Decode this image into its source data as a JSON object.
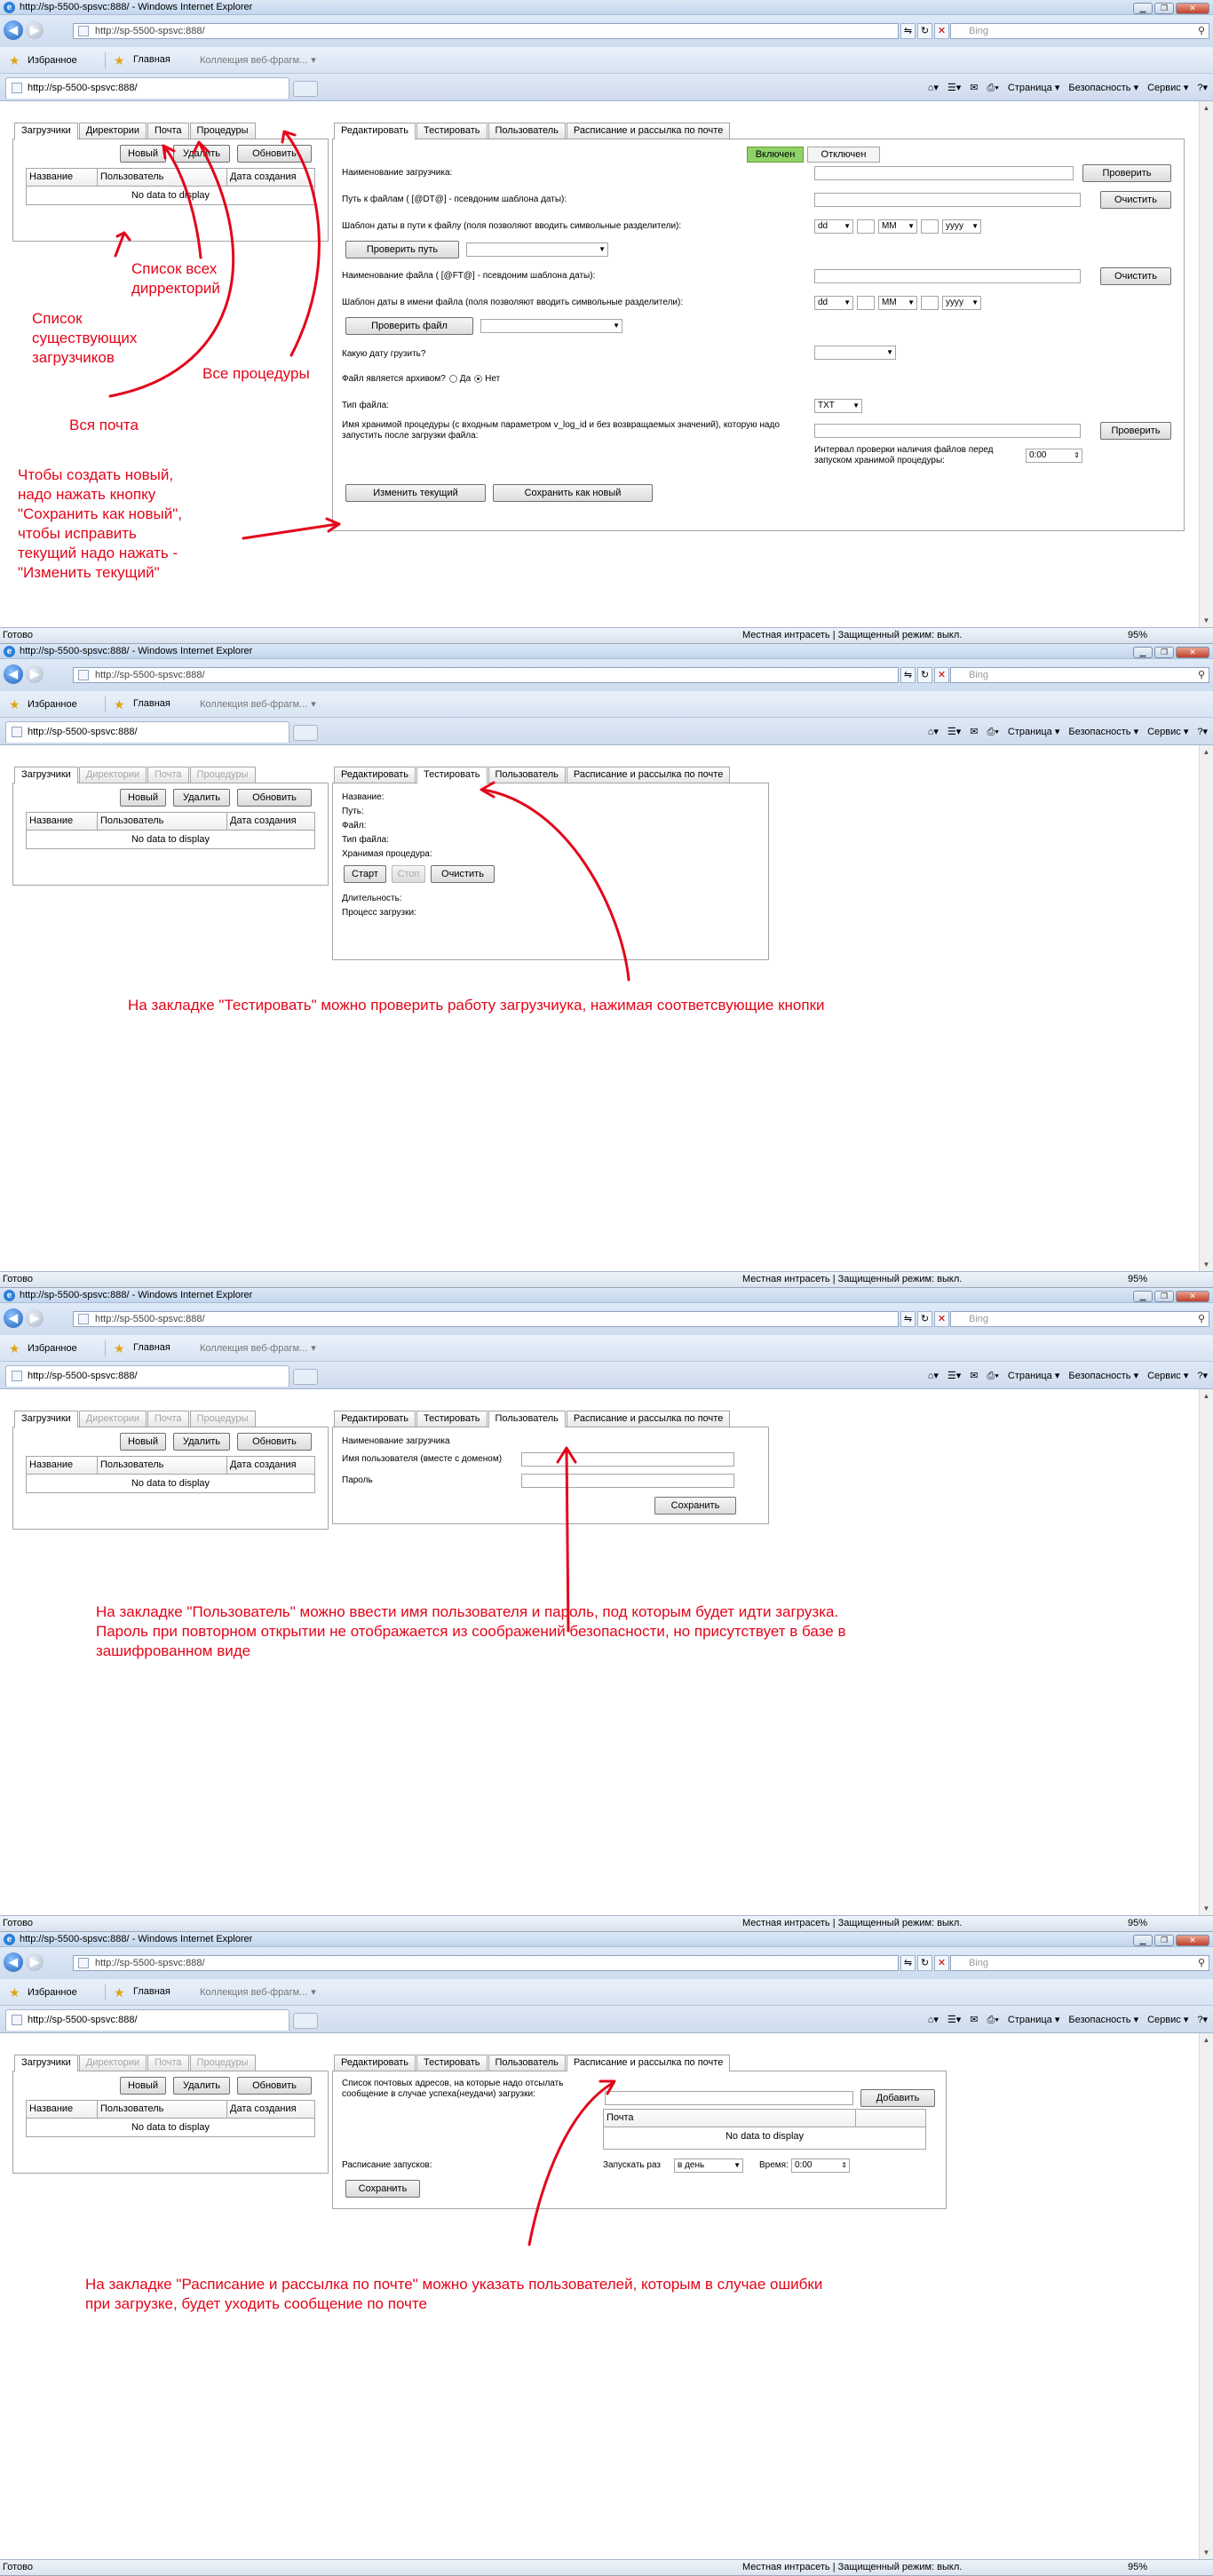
{
  "ie": {
    "title": "http://sp-5500-spsvc:888/ - Windows Internet Explorer",
    "address": "http://sp-5500-spsvc:888/",
    "search_placeholder": "Bing",
    "favorites": "Избранное",
    "home_link": "Главная",
    "webslice": "Коллекция веб-фрагм...",
    "tab_title": "http://sp-5500-spsvc:888/",
    "cmd_page": "Страница ▾",
    "cmd_safety": "Безопасность ▾",
    "cmd_service": "Сервис ▾",
    "status_ready": "Готово",
    "status_zone": "Местная интрасеть | Защищенный режим: выкл.",
    "zoom": "95%"
  },
  "left": {
    "tabs": [
      "Загрузчики",
      "Директории",
      "Почта",
      "Процедуры"
    ],
    "btn_new": "Новый",
    "btn_delete": "Удалить",
    "btn_refresh": "Обновить",
    "col_name": "Название",
    "col_user": "Пользователь",
    "col_created": "Дата создания",
    "empty": "No data to display"
  },
  "right_tabs": [
    "Редактировать",
    "Тестировать",
    "Пользователь",
    "Расписание и рассылка по почте"
  ],
  "edit": {
    "toggle_on": "Включен",
    "toggle_off": "Отключен",
    "l_name": "Наименование загрузчика:",
    "l_path": "Путь к файлам ( [@DT@] - псевдоним шаблона даты):",
    "l_path_tpl": "Шаблон даты в пути к файлу (поля позволяют вводить символьные разделители):",
    "l_filename": "Наименование файла ( [@FT@] - псевдоним шаблона даты):",
    "l_file_tpl": "Шаблон даты в имени файла (поля позволяют вводить символьные разделители):",
    "l_which_date": "Какую дату грузить?",
    "l_archive": "Файл является архивом?",
    "opt_yes": "Да",
    "opt_no": "Нет",
    "l_type": "Тип файла:",
    "type_value": "TXT",
    "l_proc": "Имя хранимой процедуры (с входным параметром v_log_id и без возвращаемых значений), которую надо запустить после загрузки файла:",
    "l_interval": "Интервал проверки наличия файлов перед запуском хранимой процедуры:",
    "interval_value": "0:00",
    "dd": "dd",
    "mm": "MM",
    "yyyy": "yyyy",
    "btn_check": "Проверить",
    "btn_clear": "Очистить",
    "btn_check_path": "Проверить путь",
    "btn_check_file": "Проверить файл",
    "btn_check_proc": "Проверить",
    "btn_update": "Изменить текущий",
    "btn_save_new": "Сохранить как новый"
  },
  "test": {
    "l_name": "Название:",
    "l_path": "Путь:",
    "l_file": "Файл:",
    "l_type": "Тип файла:",
    "l_proc": "Хранимая процедура:",
    "btn_start": "Старт",
    "btn_stop": "Стоп",
    "btn_clear": "Очистить",
    "l_duration": "Длительность:",
    "l_progress": "Процесс загрузки:"
  },
  "user": {
    "l_loader": "Наименование загрузчика",
    "l_username": "Имя пользователя (вместе с доменом)",
    "l_password": "Пароль",
    "btn_save": "Сохранить"
  },
  "schedule": {
    "l_emails": "Список почтовых адресов, на которые надо отсылать сообщение в случае успеха(неудачи) загрузки:",
    "btn_add": "Добавить",
    "col_mail": "Почта",
    "empty": "No data to display",
    "l_schedule": "Расписание запусков:",
    "l_run": "Запускать раз",
    "run_value": "в день",
    "l_time": "Время:",
    "time_value": "0:00",
    "btn_save": "Сохранить"
  },
  "notes": {
    "list_loaders": "Список\nсуществующих\nзагрузчиков",
    "list_dirs": "Список всех\nдиррекτорий",
    "all_mail": "Вся почта",
    "all_procs": "Все процедуры",
    "create_new": "Чтобы создать новый,\nнадо нажать кнопку\n\"Сохранить как новый\",\nчтобы исправить\nтекущий надо нажать -\n\"Изменить текущий\"",
    "test_tab": "На закладке \"Тестировать\" можно проверить работу загрузчиука, нажимая соответсвующие кнопки",
    "user_tab": "На закладке \"Пользователь\" можно ввести имя пользователя и пароль, под которым будет идти загрузка.\nПароль при повторном открытии не отображается из соображений безопасности, но присутствует в базе в\nзашифрованном виде",
    "schedule_tab": "На закладке \"Расписание и рассылка по почте\" можно указать пользователей, которым в случае ошибки\nпри загрузке, будет уходить сообщение по почте"
  },
  "colors": {
    "annotation": "#e3061a",
    "toggle_on": "#8fd26a"
  }
}
